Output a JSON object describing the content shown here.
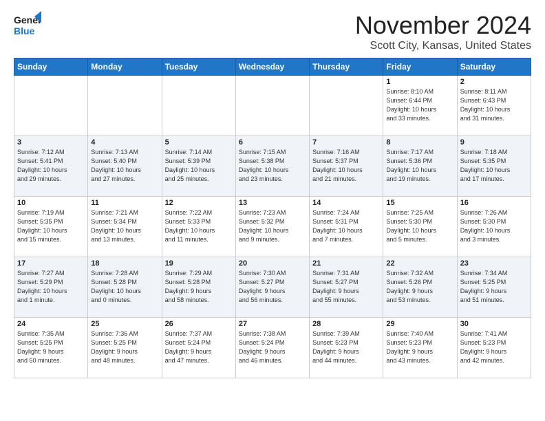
{
  "logo": {
    "line1": "General",
    "line2": "Blue"
  },
  "header": {
    "month": "November 2024",
    "location": "Scott City, Kansas, United States"
  },
  "weekdays": [
    "Sunday",
    "Monday",
    "Tuesday",
    "Wednesday",
    "Thursday",
    "Friday",
    "Saturday"
  ],
  "weeks": [
    [
      {
        "day": "",
        "info": ""
      },
      {
        "day": "",
        "info": ""
      },
      {
        "day": "",
        "info": ""
      },
      {
        "day": "",
        "info": ""
      },
      {
        "day": "",
        "info": ""
      },
      {
        "day": "1",
        "info": "Sunrise: 8:10 AM\nSunset: 6:44 PM\nDaylight: 10 hours\nand 33 minutes."
      },
      {
        "day": "2",
        "info": "Sunrise: 8:11 AM\nSunset: 6:43 PM\nDaylight: 10 hours\nand 31 minutes."
      }
    ],
    [
      {
        "day": "3",
        "info": "Sunrise: 7:12 AM\nSunset: 5:41 PM\nDaylight: 10 hours\nand 29 minutes."
      },
      {
        "day": "4",
        "info": "Sunrise: 7:13 AM\nSunset: 5:40 PM\nDaylight: 10 hours\nand 27 minutes."
      },
      {
        "day": "5",
        "info": "Sunrise: 7:14 AM\nSunset: 5:39 PM\nDaylight: 10 hours\nand 25 minutes."
      },
      {
        "day": "6",
        "info": "Sunrise: 7:15 AM\nSunset: 5:38 PM\nDaylight: 10 hours\nand 23 minutes."
      },
      {
        "day": "7",
        "info": "Sunrise: 7:16 AM\nSunset: 5:37 PM\nDaylight: 10 hours\nand 21 minutes."
      },
      {
        "day": "8",
        "info": "Sunrise: 7:17 AM\nSunset: 5:36 PM\nDaylight: 10 hours\nand 19 minutes."
      },
      {
        "day": "9",
        "info": "Sunrise: 7:18 AM\nSunset: 5:35 PM\nDaylight: 10 hours\nand 17 minutes."
      }
    ],
    [
      {
        "day": "10",
        "info": "Sunrise: 7:19 AM\nSunset: 5:35 PM\nDaylight: 10 hours\nand 15 minutes."
      },
      {
        "day": "11",
        "info": "Sunrise: 7:21 AM\nSunset: 5:34 PM\nDaylight: 10 hours\nand 13 minutes."
      },
      {
        "day": "12",
        "info": "Sunrise: 7:22 AM\nSunset: 5:33 PM\nDaylight: 10 hours\nand 11 minutes."
      },
      {
        "day": "13",
        "info": "Sunrise: 7:23 AM\nSunset: 5:32 PM\nDaylight: 10 hours\nand 9 minutes."
      },
      {
        "day": "14",
        "info": "Sunrise: 7:24 AM\nSunset: 5:31 PM\nDaylight: 10 hours\nand 7 minutes."
      },
      {
        "day": "15",
        "info": "Sunrise: 7:25 AM\nSunset: 5:30 PM\nDaylight: 10 hours\nand 5 minutes."
      },
      {
        "day": "16",
        "info": "Sunrise: 7:26 AM\nSunset: 5:30 PM\nDaylight: 10 hours\nand 3 minutes."
      }
    ],
    [
      {
        "day": "17",
        "info": "Sunrise: 7:27 AM\nSunset: 5:29 PM\nDaylight: 10 hours\nand 1 minute."
      },
      {
        "day": "18",
        "info": "Sunrise: 7:28 AM\nSunset: 5:28 PM\nDaylight: 10 hours\nand 0 minutes."
      },
      {
        "day": "19",
        "info": "Sunrise: 7:29 AM\nSunset: 5:28 PM\nDaylight: 9 hours\nand 58 minutes."
      },
      {
        "day": "20",
        "info": "Sunrise: 7:30 AM\nSunset: 5:27 PM\nDaylight: 9 hours\nand 56 minutes."
      },
      {
        "day": "21",
        "info": "Sunrise: 7:31 AM\nSunset: 5:27 PM\nDaylight: 9 hours\nand 55 minutes."
      },
      {
        "day": "22",
        "info": "Sunrise: 7:32 AM\nSunset: 5:26 PM\nDaylight: 9 hours\nand 53 minutes."
      },
      {
        "day": "23",
        "info": "Sunrise: 7:34 AM\nSunset: 5:25 PM\nDaylight: 9 hours\nand 51 minutes."
      }
    ],
    [
      {
        "day": "24",
        "info": "Sunrise: 7:35 AM\nSunset: 5:25 PM\nDaylight: 9 hours\nand 50 minutes."
      },
      {
        "day": "25",
        "info": "Sunrise: 7:36 AM\nSunset: 5:25 PM\nDaylight: 9 hours\nand 48 minutes."
      },
      {
        "day": "26",
        "info": "Sunrise: 7:37 AM\nSunset: 5:24 PM\nDaylight: 9 hours\nand 47 minutes."
      },
      {
        "day": "27",
        "info": "Sunrise: 7:38 AM\nSunset: 5:24 PM\nDaylight: 9 hours\nand 46 minutes."
      },
      {
        "day": "28",
        "info": "Sunrise: 7:39 AM\nSunset: 5:23 PM\nDaylight: 9 hours\nand 44 minutes."
      },
      {
        "day": "29",
        "info": "Sunrise: 7:40 AM\nSunset: 5:23 PM\nDaylight: 9 hours\nand 43 minutes."
      },
      {
        "day": "30",
        "info": "Sunrise: 7:41 AM\nSunset: 5:23 PM\nDaylight: 9 hours\nand 42 minutes."
      }
    ]
  ]
}
